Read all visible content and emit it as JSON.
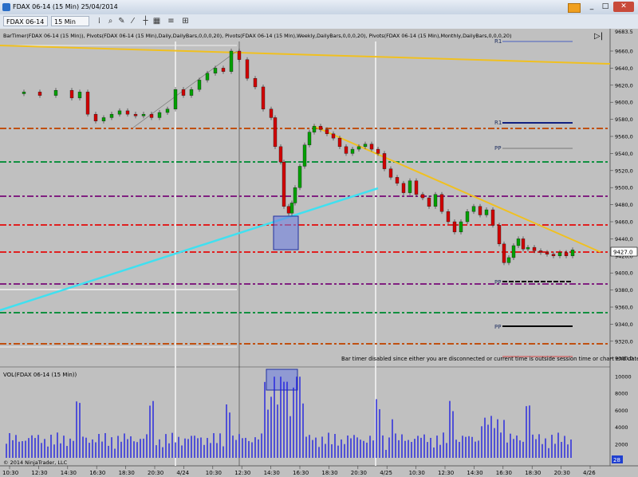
{
  "window": {
    "title": "FDAX 06-14 (15 Min)  25/04/2014",
    "close_label": "✕",
    "min_label": "_",
    "max_label": "□"
  },
  "toolbar": {
    "instrument": "FDAX 06-14",
    "interval": "15 Min"
  },
  "price_panel": {
    "indicator_text": "BarTimer(FDAX 06-14 (15 Min)), Pivots(FDAX 06-14 (15 Min),Daily,DailyBars,0,0,0,20), Pivots(FDAX 06-14 (15 Min),Weekly,DailyBars,0,0,0,20), Pivots(FDAX 06-14 (15 Min),Monthly,DailyBars,0,0,0,20)",
    "current_price": "9427.0",
    "axis_top_label": "9683.5",
    "y_ticks": [
      "9660,0",
      "9640,0",
      "9620,0",
      "9600,0",
      "9580,0",
      "9560,0",
      "9540,0",
      "9520,0",
      "9500,0",
      "9480,0",
      "9460,0",
      "9440,0",
      "9420,0",
      "9400,0",
      "9380,0",
      "9360,0",
      "9340,0",
      "9320,0",
      "9300,0"
    ],
    "pivot_labels": [
      "R1",
      "R1",
      "PP",
      "PP",
      "PP"
    ],
    "bartimer_msg": "Bar timer disabled since either you are disconnected or current time is outside session time or chart end date"
  },
  "volume_panel": {
    "label": "VOL(FDAX 06-14 (15 Min))",
    "y_ticks": [
      "10000",
      "8000",
      "6000",
      "4000",
      "2000"
    ],
    "current_vol": "28",
    "copyright": "© 2014 NinjaTrader, LLC"
  },
  "x_axis": {
    "labels": [
      "10:30",
      "12:30",
      "14:30",
      "16:30",
      "18:30",
      "20:30",
      "4/24",
      "10:30",
      "12:30",
      "14:30",
      "16:30",
      "18:30",
      "20:30",
      "4/25",
      "10:30",
      "12:30",
      "14:30",
      "16:30",
      "18:30",
      "20:30",
      "4/26"
    ]
  },
  "colors": {
    "bg": "#c0c0c0",
    "up": "#00a000",
    "down": "#d00000",
    "volume": "#2020e0",
    "trend": "#f0c020",
    "cyan": "#40e0f0"
  }
}
